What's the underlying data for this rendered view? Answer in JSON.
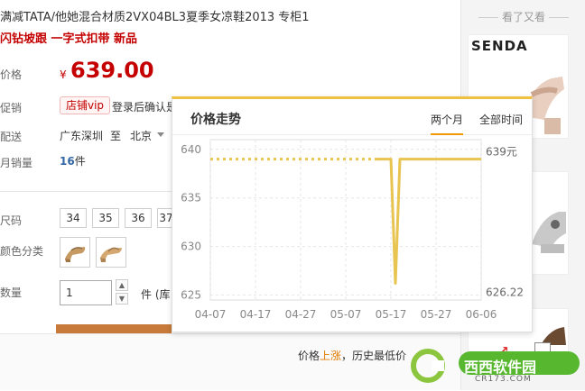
{
  "product": {
    "title": "满减TATA/他她混合材质2VX04BL3夏季女凉鞋2013 专柜1",
    "subtitle": "闪钻坡跟 一字式扣带 新品",
    "price_label": "价格",
    "price_symbol": "¥",
    "price": "639.00",
    "promo_label": "促销",
    "vip_badge": "店铺vip",
    "login_hint": "登录后确认是",
    "ship_label": "配送",
    "ship_from": "广东深圳",
    "ship_to_word": "至",
    "ship_to": "北京",
    "sales_label": "月销量",
    "sales_count": "16",
    "sales_unit": "件",
    "size_label": "尺码",
    "sizes": [
      "34",
      "35",
      "36",
      "37"
    ],
    "color_label": "颜色分类",
    "qty_label": "数量",
    "qty_value": "1",
    "qty_unit": "件 (库",
    "history_prefix": "价格",
    "history_trend": "上涨",
    "history_suffix": "，历史最低价"
  },
  "sidebar": {
    "title": "看了又看",
    "brand": "SENDA"
  },
  "price_popup": {
    "title": "价格走势",
    "tab_two_months": "两个月",
    "tab_all_time": "全部时间",
    "max_label": "639元",
    "min_label": "626.22"
  },
  "watermark": {
    "text": "西西软件园",
    "sub": "CR173.COM"
  },
  "colors": {
    "price_red": "#c40000",
    "line": "#e8c450",
    "accent": "#f39800"
  },
  "chart_data": {
    "type": "line",
    "x": [
      "04-07",
      "04-17",
      "04-27",
      "05-07",
      "05-17",
      "05-27",
      "06-06"
    ],
    "yticks": [
      625,
      630,
      635,
      640
    ],
    "ylim": [
      624.5,
      641
    ],
    "series": [
      {
        "style": "dotted",
        "points": [
          [
            "04-07",
            639
          ],
          [
            "05-14",
            639
          ]
        ]
      },
      {
        "style": "solid",
        "points": [
          [
            "05-14",
            639
          ],
          [
            "05-17",
            639
          ],
          [
            "05-18",
            626.22
          ],
          [
            "05-19",
            639
          ],
          [
            "06-06",
            639
          ]
        ]
      }
    ],
    "grid": true
  }
}
